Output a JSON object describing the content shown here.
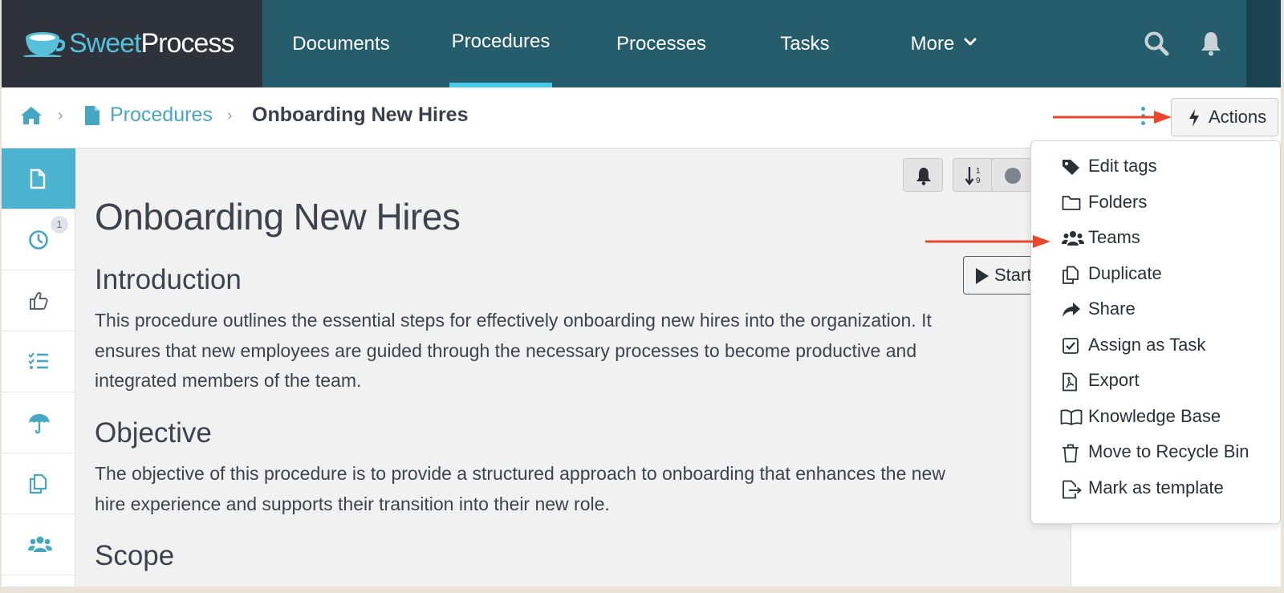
{
  "brand": {
    "part1": "Sweet",
    "part2": "Process"
  },
  "nav": {
    "items": [
      {
        "label": "Documents"
      },
      {
        "label": "Procedures"
      },
      {
        "label": "Processes"
      },
      {
        "label": "Tasks"
      },
      {
        "label": "More"
      }
    ],
    "active": "Procedures",
    "icons": [
      "search-icon",
      "bell-icon",
      "chevron-down-icon"
    ]
  },
  "breadcrumb": {
    "section": "Procedures",
    "current": "Onboarding New Hires",
    "icons": [
      "home-icon",
      "document-icon"
    ]
  },
  "actions": {
    "label": "Actions",
    "icon": "bolt-icon"
  },
  "rail": {
    "history_badge": "1",
    "icons": [
      "document-icon",
      "clock-icon",
      "thumbs-up-icon",
      "checklist-icon",
      "umbrella-icon",
      "copy-icon",
      "team-icon"
    ]
  },
  "toolbar": {
    "start_label": "Start"
  },
  "document": {
    "title": "Onboarding New Hires",
    "sections": [
      {
        "heading": "Introduction",
        "text": "This procedure outlines the essential steps for effectively onboarding new hires into the organization. It ensures that new employees are guided through the necessary processes to become productive and integrated members of the team."
      },
      {
        "heading": "Objective",
        "text": "The objective of this procedure is to provide a structured approach to onboarding that enhances the new hire experience and supports their transition into their new role."
      },
      {
        "heading": "Scope",
        "text": ""
      }
    ]
  },
  "menu": {
    "items": [
      {
        "label": "Edit tags",
        "icon": "tag-icon"
      },
      {
        "label": "Folders",
        "icon": "folder-icon"
      },
      {
        "label": "Teams",
        "icon": "users-icon"
      },
      {
        "label": "Duplicate",
        "icon": "duplicate-icon"
      },
      {
        "label": "Share",
        "icon": "share-icon"
      },
      {
        "label": "Assign as Task",
        "icon": "checkbox-icon"
      },
      {
        "label": "Export",
        "icon": "pdf-file-icon"
      },
      {
        "label": "Knowledge Base",
        "icon": "book-icon"
      },
      {
        "label": "Move to Recycle Bin",
        "icon": "trash-icon"
      },
      {
        "label": "Mark as template",
        "icon": "template-icon"
      }
    ]
  },
  "colors": {
    "nav_bg": "#255d6c",
    "brand_bg": "#2d323b",
    "accent": "#47cbe8",
    "link": "#47a6c1",
    "annotation_arrow": "#e8472c"
  }
}
